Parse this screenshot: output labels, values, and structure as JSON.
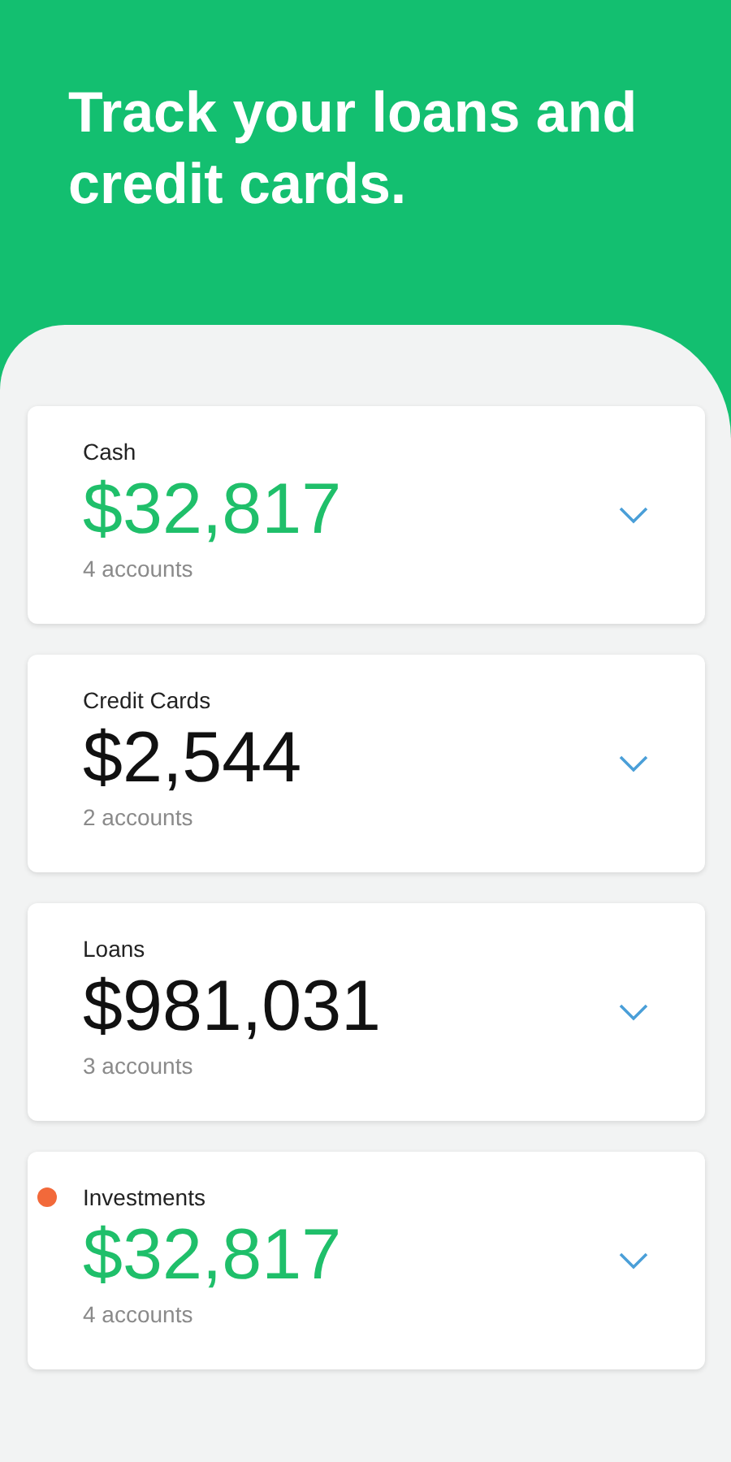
{
  "headline": "Track your loans and credit cards.",
  "accounts": [
    {
      "label": "Cash",
      "amount": "$32,817",
      "count": "4 accounts",
      "color": "#1fbf6a",
      "flagged": false,
      "expanded": false
    },
    {
      "label": "Credit Cards",
      "amount": "$2,544",
      "count": "2 accounts",
      "color": "#111111",
      "flagged": false,
      "expanded": false
    },
    {
      "label": "Loans",
      "amount": "$981,031",
      "count": "3 accounts",
      "color": "#111111",
      "flagged": false,
      "expanded": false
    },
    {
      "label": "Investments",
      "amount": "$32,817",
      "count": "4 accounts",
      "color": "#1fbf6a",
      "flagged": true,
      "expanded": false
    }
  ]
}
